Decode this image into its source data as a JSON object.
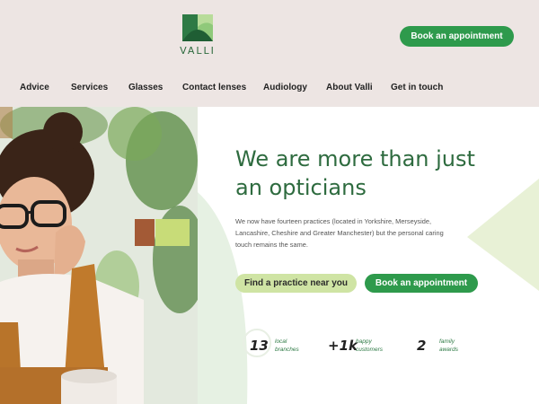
{
  "brand": {
    "name": "VALLI"
  },
  "header": {
    "cta_label": "Book an appointment"
  },
  "nav": {
    "items": [
      "Advice",
      "Services",
      "Glasses",
      "Contact lenses",
      "Audiology",
      "About Valli",
      "Get in touch"
    ]
  },
  "hero": {
    "title_line1": "We are more than just",
    "title_line2": "an opticians",
    "description": "We now have fourteen practices (located in Yorkshire, Merseyside, Lancashire, Cheshire and Greater Manchester) but the personal caring touch remains the same.",
    "find_label": "Find a practice near you",
    "book_label": "Book an appointment"
  },
  "stats": [
    {
      "value": "13",
      "label_line1": "local",
      "label_line2": "branches"
    },
    {
      "value": "+1k",
      "label_line1": "happy",
      "label_line2": "customers"
    },
    {
      "value": "2",
      "label_line1": "family",
      "label_line2": "awards"
    }
  ],
  "colors": {
    "brand_green": "#2e9a4c",
    "dark_green": "#2e6b3f",
    "light_green": "#cfe4a4",
    "header_bg": "#ede5e3"
  }
}
